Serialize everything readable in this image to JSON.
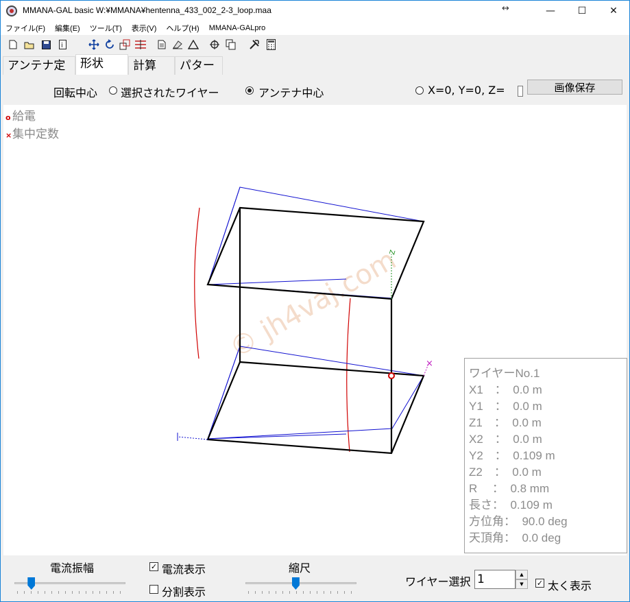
{
  "window": {
    "title": "MMANA-GAL basic W:¥MMANA¥hentenna_433_002_2-3_loop.maa",
    "minimize": "—",
    "maximize": "☐",
    "close": "✕"
  },
  "menu": [
    "ファイル(F)",
    "編集(E)",
    "ツール(T)",
    "表示(V)",
    "ヘルプ(H)",
    "MMANA-GALpro"
  ],
  "toolbar_icons": [
    "new-file-icon",
    "open-folder-icon",
    "save-disk-icon",
    "info-icon",
    "move-icon",
    "rotate-icon",
    "zoom-icon",
    "ruler-icon",
    "page-icon",
    "eraser-icon",
    "triangle-icon",
    "target-icon",
    "copy-icon",
    "tools-icon",
    "calculator-icon"
  ],
  "tabs": [
    "アンテナ定義",
    "形状",
    "計算",
    "パターン"
  ],
  "active_tab": "形状",
  "rotation": {
    "label": "回転中心",
    "option1": "選択されたワイヤー",
    "option2": "アンテナ中心",
    "option3": "X=0, Y=0, Z=",
    "selected": "アンテナ中心",
    "save_button": "画像保存"
  },
  "legend": {
    "feed_mark": "o",
    "feed": "給電",
    "load_mark": "×",
    "load": "集中定数"
  },
  "view": {
    "z_axis_label": "Z",
    "watermark": "© jh4vaj.com",
    "colors": {
      "wire": "#000000",
      "current": "#1010d0",
      "red_trace": "#d00000",
      "feed": "#d00000",
      "axis_z": "#209020",
      "axis_y": "#c020c0"
    }
  },
  "wire_info": {
    "title": "ワイヤーNo.1",
    "rows": [
      "X1　：  0.0 m",
      "Y1　：  0.0 m",
      "Z1　：  0.0 m",
      "X2　：  0.0 m",
      "Y2　：  0.109 m",
      "Z2　：  0.0 m",
      "R　 ：  0.8 mm",
      "長さ：  0.109 m",
      "方位角：  90.0 deg",
      "天頂角：  0.0 deg"
    ]
  },
  "bottom": {
    "current_amp": "電流振幅",
    "current_amp_level": 0.15,
    "show_current": "電流表示",
    "show_current_checked": true,
    "show_segments": "分割表示",
    "show_segments_checked": false,
    "scale": "縮尺",
    "scale_level": 0.45,
    "wire_select": "ワイヤー選択",
    "wire_select_value": "1",
    "bold_display": "太く表示",
    "bold_display_checked": true
  }
}
